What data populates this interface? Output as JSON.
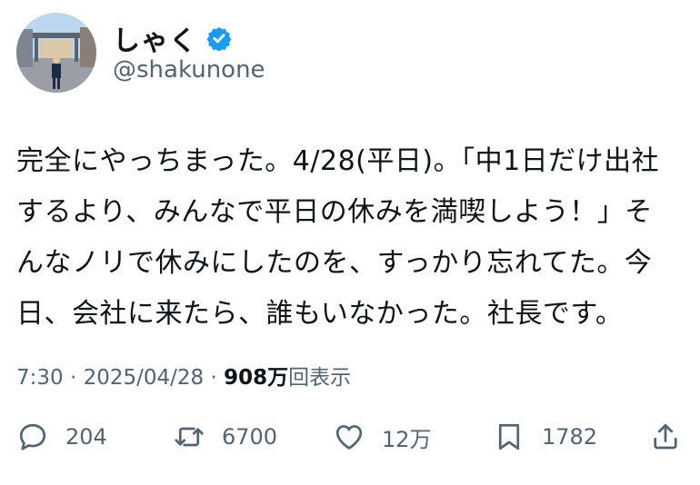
{
  "author": {
    "display_name": "しゃく",
    "handle": "@shakunone",
    "verified": true
  },
  "tweet": {
    "text": "完全にやっちまった。4/28(平日)。「中1日だけ出社\nするより、みんなで平日の休みを満喫しよう！」そ\nんなノリで休みにしたのを、すっかり忘れてた。今\n日、会社に来たら、誰もいなかった。社長です。"
  },
  "meta": {
    "time": "7:30",
    "sep1": "·",
    "date": "2025/04/28",
    "sep2": "·",
    "views_count": "908万",
    "views_label": "回表示"
  },
  "actions": {
    "reply": {
      "icon": "reply-icon",
      "count": "204"
    },
    "retweet": {
      "icon": "retweet-icon",
      "count": "6700"
    },
    "like": {
      "icon": "heart-icon",
      "count": "12万"
    },
    "bookmark": {
      "icon": "bookmark-icon",
      "count": "1782"
    },
    "share": {
      "icon": "share-icon"
    }
  },
  "colors": {
    "text_primary": "#0f1419",
    "text_secondary": "#536471",
    "verified_blue": "#1d9bf0",
    "background": "#ffffff"
  }
}
